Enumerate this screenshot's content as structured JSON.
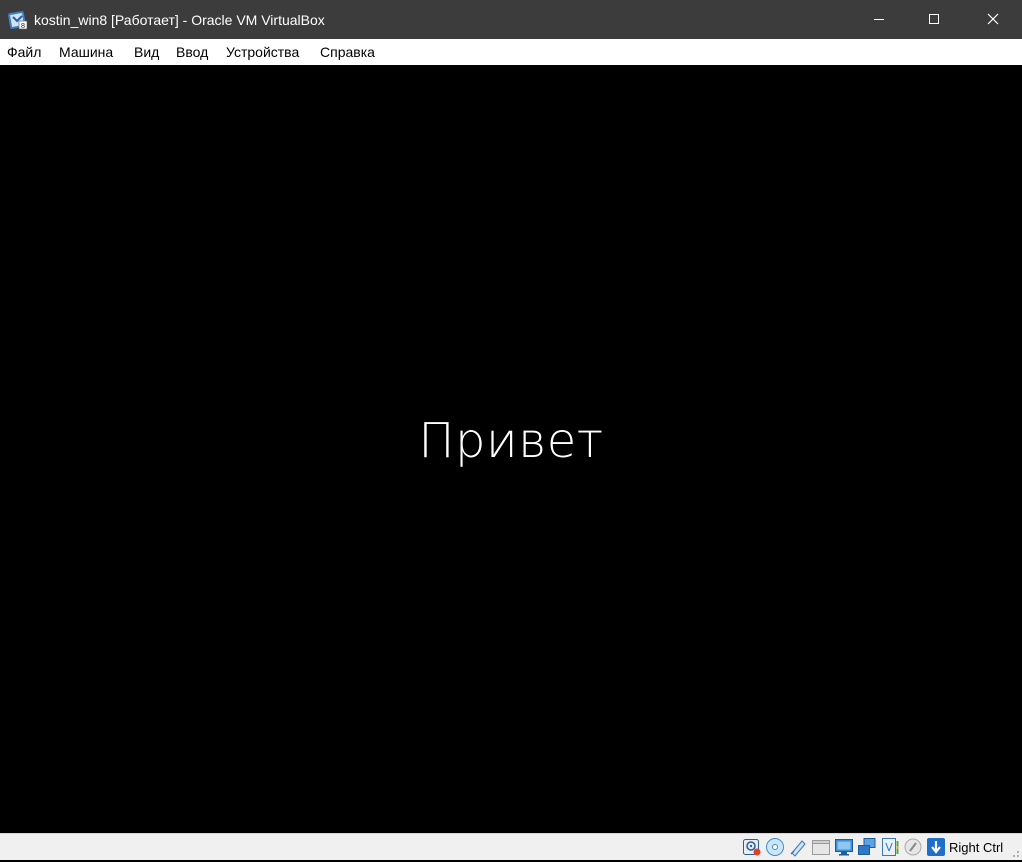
{
  "window": {
    "title": "kostin_win8 [Работает] - Oracle VM VirtualBox",
    "icon": "virtualbox-win8-icon",
    "controls": [
      "minimize-icon",
      "maximize-icon",
      "close-icon"
    ]
  },
  "menu": {
    "items": [
      {
        "label": "Файл"
      },
      {
        "label": "Машина"
      },
      {
        "label": "Вид"
      },
      {
        "label": "Ввод"
      },
      {
        "label": "Устройства"
      },
      {
        "label": "Справка"
      }
    ]
  },
  "vm_screen": {
    "greeting": "Привет",
    "background": "#000000",
    "text_color": "#ffffff"
  },
  "statusbar": {
    "icons": [
      "hard-disk-icon",
      "optical-drive-icon",
      "usb-icon",
      "shared-folders-icon",
      "display-icon",
      "network-icon",
      "video-capture-icon",
      "cpu-icon",
      "mouse-integration-icon",
      "keyboard-capture-icon"
    ],
    "host_key": "Right Ctrl"
  },
  "colors": {
    "titlebar": "#3c3c3c",
    "menubar": "#ffffff",
    "statusbar": "#f0f0f0",
    "accent_blue": "#1e7bd6"
  }
}
